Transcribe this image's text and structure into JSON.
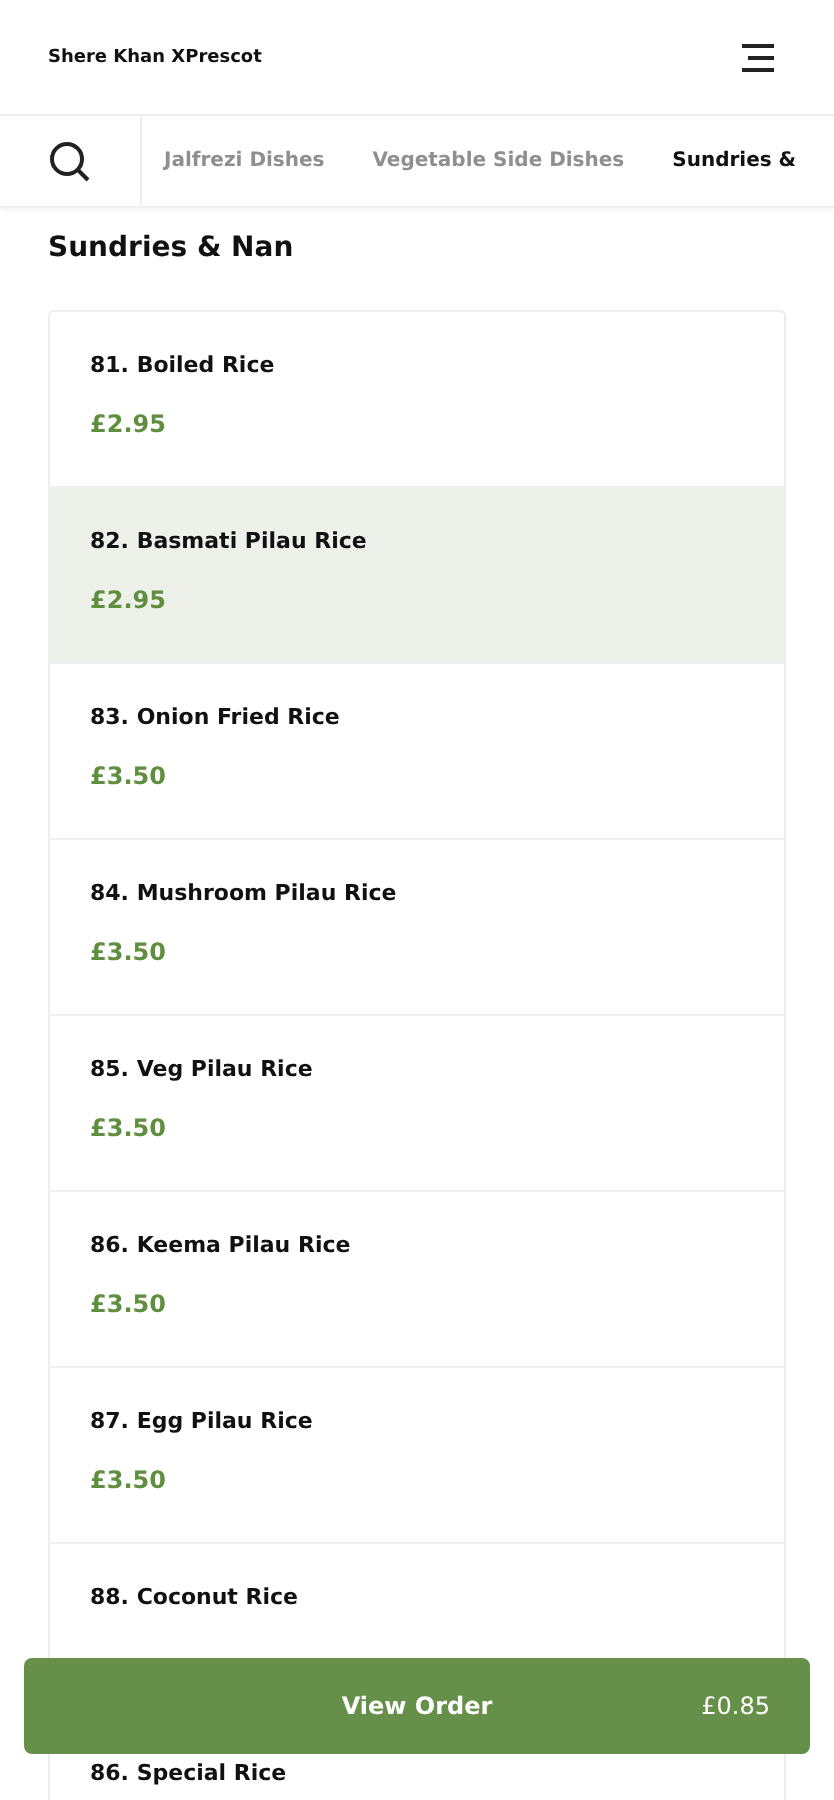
{
  "header": {
    "title": "Shere Khan XPrescot"
  },
  "tabs": [
    {
      "label": "Jalfrezi Dishes",
      "selected": false
    },
    {
      "label": "Vegetable Side Dishes",
      "selected": false
    },
    {
      "label": "Sundries &",
      "selected": true
    }
  ],
  "section_title": "Sundries & Nan",
  "items": [
    {
      "name": "81. Boiled Rice",
      "price": "£2.95",
      "highlighted": false
    },
    {
      "name": "82. Basmati Pilau Rice",
      "price": "£2.95",
      "highlighted": true
    },
    {
      "name": "83. Onion Fried Rice",
      "price": "£3.50",
      "highlighted": false
    },
    {
      "name": "84. Mushroom Pilau Rice",
      "price": "£3.50",
      "highlighted": false
    },
    {
      "name": "85. Veg Pilau Rice",
      "price": "£3.50",
      "highlighted": false
    },
    {
      "name": "86. Keema Pilau Rice",
      "price": "£3.50",
      "highlighted": false
    },
    {
      "name": "87. Egg Pilau Rice",
      "price": "£3.50",
      "highlighted": false
    },
    {
      "name": "88. Coconut Rice",
      "highlighted": false
    },
    {
      "name": "86. Special Rice",
      "highlighted": false
    }
  ],
  "order_button": {
    "label": "View Order",
    "total": "£0.85"
  }
}
